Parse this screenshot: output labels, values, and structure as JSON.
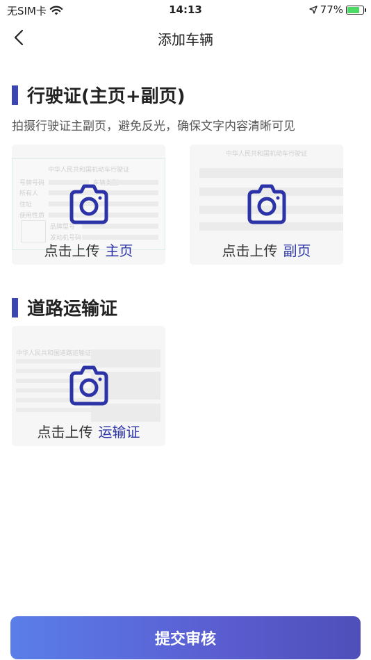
{
  "status_bar": {
    "carrier": "无SIM卡",
    "time": "14:13",
    "battery_percent": "77%",
    "battery_level": 0.77
  },
  "nav": {
    "title": "添加车辆"
  },
  "license_section": {
    "title": "行驶证(主页+副页)",
    "hint": "拍摄行驶证主副页，避免反光，确保文字内容清晰可见",
    "front_card": {
      "label_prefix": "点击上传",
      "label_accent": "主页",
      "bg_title": "中华人民共和国机动车行驶证",
      "bg_fields": [
        "号牌号码",
        "车辆类型",
        "所有人",
        "住址",
        "使用性质",
        "品牌型号",
        "发动机号码"
      ]
    },
    "back_card": {
      "label_prefix": "点击上传",
      "label_accent": "副页",
      "bg_title": "中华人民共和国机动车行驶证"
    }
  },
  "transport_section": {
    "title": "道路运输证",
    "card": {
      "label_prefix": "点击上传",
      "label_accent": "运输证",
      "bg_title": "中华人民共和国道路运输证"
    }
  },
  "submit": {
    "label": "提交审核"
  },
  "colors": {
    "accent": "#3c47b2",
    "accent_text": "#2b33a6",
    "button_start": "#5a7ee8",
    "button_end": "#4f4fba"
  }
}
